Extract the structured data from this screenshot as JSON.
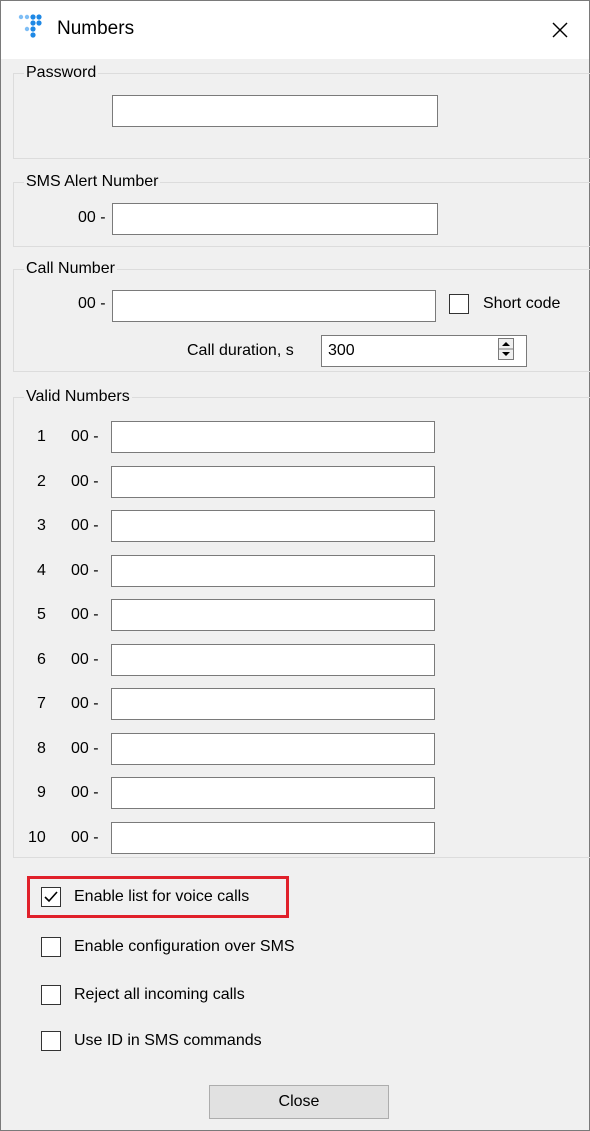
{
  "window": {
    "title": "Numbers"
  },
  "password": {
    "legend": "Password",
    "value": ""
  },
  "sms_alert": {
    "legend": "SMS Alert Number",
    "prefix": "00 -",
    "value": ""
  },
  "call_number": {
    "legend": "Call Number",
    "prefix": "00 -",
    "value": "",
    "short_code_label": "Short code",
    "short_code_checked": false,
    "duration_label": "Call duration, s",
    "duration_value": "300"
  },
  "valid_numbers": {
    "legend": "Valid Numbers",
    "prefix": "00 -",
    "items": [
      {
        "index": "1",
        "value": ""
      },
      {
        "index": "2",
        "value": ""
      },
      {
        "index": "3",
        "value": ""
      },
      {
        "index": "4",
        "value": ""
      },
      {
        "index": "5",
        "value": ""
      },
      {
        "index": "6",
        "value": ""
      },
      {
        "index": "7",
        "value": ""
      },
      {
        "index": "8",
        "value": ""
      },
      {
        "index": "9",
        "value": ""
      },
      {
        "index": "10",
        "value": ""
      }
    ]
  },
  "options": [
    {
      "label": "Enable list for voice calls",
      "checked": true
    },
    {
      "label": "Enable configuration over SMS",
      "checked": false
    },
    {
      "label": "Reject all incoming calls",
      "checked": false
    },
    {
      "label": "Use ID in SMS commands",
      "checked": false
    }
  ],
  "close_button": "Close",
  "colors": {
    "highlight": "#e0202a",
    "icon_blue": "#1e88e5"
  }
}
